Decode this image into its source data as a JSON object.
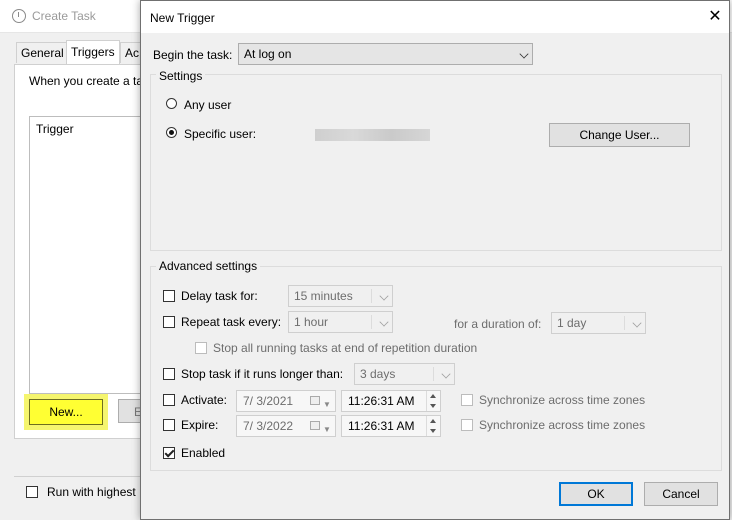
{
  "background_window": {
    "title": "Create Task",
    "tabs": [
      {
        "label": "General"
      },
      {
        "label": "Triggers"
      },
      {
        "label": "Ac"
      }
    ],
    "description": "When you create a ta",
    "list_header": "Trigger",
    "new_button": "New...",
    "edit_button": "E",
    "run_highest": "Run with highest"
  },
  "dialog": {
    "title": "New Trigger",
    "close_glyph": "✕",
    "begin_label": "Begin the task:",
    "begin_value": "At log on",
    "settings": {
      "title": "Settings",
      "any_user": "Any user",
      "specific_user": "Specific user:",
      "selected": "specific_user",
      "change_user_button": "Change User..."
    },
    "advanced": {
      "title": "Advanced settings",
      "delay_label": "Delay task for:",
      "delay_value": "15 minutes",
      "repeat_label": "Repeat task every:",
      "repeat_value": "1 hour",
      "duration_label": "for a duration of:",
      "duration_value": "1 day",
      "stop_running": "Stop all running tasks at end of repetition duration",
      "stop_longer_label": "Stop task if it runs longer than:",
      "stop_longer_value": "3 days",
      "activate_label": "Activate:",
      "activate_date": "7/  3/2021",
      "activate_time": "11:26:31 AM",
      "expire_label": "Expire:",
      "expire_date": "7/  3/2022",
      "expire_time": "11:26:31 AM",
      "sync_label": "Synchronize across time zones",
      "enabled_label": "Enabled",
      "enabled_checked": true
    },
    "ok_button": "OK",
    "cancel_button": "Cancel"
  },
  "colors": {
    "highlight": "#ffff33",
    "default_button_border": "#0078d7"
  }
}
